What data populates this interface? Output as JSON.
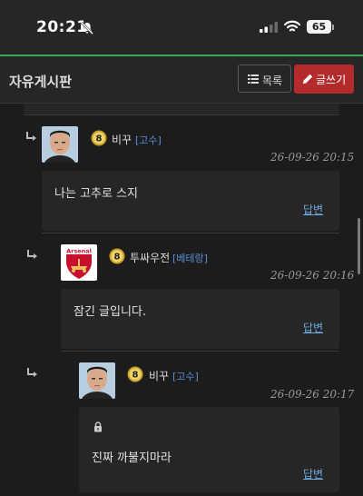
{
  "status_bar": {
    "time": "20:21",
    "battery": "65"
  },
  "header": {
    "title": "자유게시판",
    "list_button": "목록",
    "write_button": "글쓰기"
  },
  "comments": [
    {
      "nickname": "비꾸",
      "grade": "[고수]",
      "level_badge": "8",
      "date": "26-09-26 20:15",
      "content": "나는 고추로 스지",
      "reply_label": "답변",
      "secret": false
    },
    {
      "nickname": "투싸우전",
      "grade": "[베테랑]",
      "level_badge": "8",
      "date": "26-09-26 20:16",
      "content": "잠긴 글입니다.",
      "reply_label": "답변",
      "avatar_text": "Arsenal",
      "secret": false
    },
    {
      "nickname": "비꾸",
      "grade": "[고수]",
      "level_badge": "8",
      "date": "26-09-26 20:17",
      "content": "진짜 까불지마라",
      "reply_label": "답변",
      "secret": true
    }
  ],
  "colors": {
    "accent_green": "#3aa757",
    "write_button": "#b52b2b",
    "link_blue": "#6ea7e2",
    "grade_blue": "#5b8fd8"
  }
}
